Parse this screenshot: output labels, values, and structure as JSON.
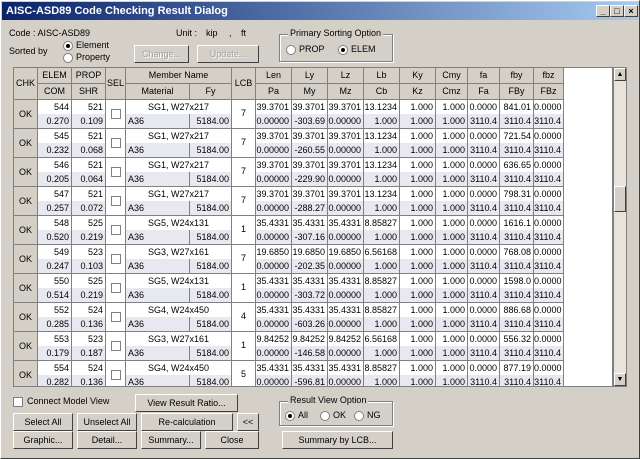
{
  "window": {
    "title": "AISC-ASD89 Code Checking Result Dialog",
    "controls": [
      "_",
      "□",
      "×"
    ]
  },
  "code": {
    "label": "Code : AISC-ASD89"
  },
  "unit": {
    "label": "Unit :",
    "force": "kip",
    "comma": ",",
    "length": "ft"
  },
  "sorted_by": {
    "label": "Sorted by",
    "options": [
      "Element",
      "Property"
    ],
    "selected": 0
  },
  "top_buttons": {
    "change": "Change...",
    "update": "Update..."
  },
  "primary_sort": {
    "title": "Primary Sorting Option",
    "options": [
      "PROP",
      "ELEM"
    ],
    "selected": 1
  },
  "headers": {
    "chk": "CHK",
    "elem": "ELEM",
    "com": "COM",
    "prop": "PROP",
    "shr": "SHR",
    "sel": "SEL",
    "member_name": "Member Name",
    "material": "Material",
    "fy": "Fy",
    "lcb": "LCB",
    "top": [
      "Len",
      "Ly",
      "Lz",
      "Lb",
      "Ky",
      "Cmy",
      "fa",
      "fby",
      "fbz"
    ],
    "bot": [
      "Pa",
      "My",
      "Mz",
      "Cb",
      "Kz",
      "Cmz",
      "Fa",
      "FBy",
      "FBz"
    ]
  },
  "rows": [
    {
      "chk": "OK",
      "elem": "544",
      "com": "0.270",
      "prop": "521",
      "shr": "0.109",
      "name": "SG1, W27x217",
      "mat": "A36",
      "fy": "5184.00",
      "lcb": "7",
      "top": [
        "39.3701",
        "39.3701",
        "39.3701",
        "13.1234",
        "1.000",
        "1.000",
        "0.0000",
        "841.01",
        "0.0000"
      ],
      "bot": [
        "0.00000",
        "-303.69",
        "0.00000",
        "1.000",
        "1.000",
        "1.000",
        "3110.4",
        "3110.4",
        "3110.4"
      ]
    },
    {
      "chk": "OK",
      "elem": "545",
      "com": "0.232",
      "prop": "521",
      "shr": "0.068",
      "name": "SG1, W27x217",
      "mat": "A36",
      "fy": "5184.00",
      "lcb": "7",
      "top": [
        "39.3701",
        "39.3701",
        "39.3701",
        "13.1234",
        "1.000",
        "1.000",
        "0.0000",
        "721.54",
        "0.0000"
      ],
      "bot": [
        "0.00000",
        "-260.55",
        "0.00000",
        "1.000",
        "1.000",
        "1.000",
        "3110.4",
        "3110.4",
        "3110.4"
      ]
    },
    {
      "chk": "OK",
      "elem": "546",
      "com": "0.205",
      "prop": "521",
      "shr": "0.064",
      "name": "SG1, W27x217",
      "mat": "A36",
      "fy": "5184.00",
      "lcb": "7",
      "top": [
        "39.3701",
        "39.3701",
        "39.3701",
        "13.1234",
        "1.000",
        "1.000",
        "0.0000",
        "636.65",
        "0.0000"
      ],
      "bot": [
        "0.00000",
        "-229.90",
        "0.00000",
        "1.000",
        "1.000",
        "1.000",
        "3110.4",
        "3110.4",
        "3110.4"
      ]
    },
    {
      "chk": "OK",
      "elem": "547",
      "com": "0.257",
      "prop": "521",
      "shr": "0.072",
      "name": "SG1, W27x217",
      "mat": "A36",
      "fy": "5184.00",
      "lcb": "7",
      "top": [
        "39.3701",
        "39.3701",
        "39.3701",
        "13.1234",
        "1.000",
        "1.000",
        "0.0000",
        "798.31",
        "0.0000"
      ],
      "bot": [
        "0.00000",
        "-288.27",
        "0.00000",
        "1.000",
        "1.000",
        "1.000",
        "3110.4",
        "3110.4",
        "3110.4"
      ]
    },
    {
      "chk": "OK",
      "elem": "548",
      "com": "0.520",
      "prop": "525",
      "shr": "0.219",
      "name": "SG5, W24x131",
      "mat": "A36",
      "fy": "5184.00",
      "lcb": "1",
      "top": [
        "35.4331",
        "35.4331",
        "35.4331",
        "8.85827",
        "1.000",
        "1.000",
        "0.0000",
        "1616.1",
        "0.0000"
      ],
      "bot": [
        "0.00000",
        "-307.16",
        "0.00000",
        "1.000",
        "1.000",
        "1.000",
        "3110.4",
        "3110.4",
        "3110.4"
      ]
    },
    {
      "chk": "OK",
      "elem": "549",
      "com": "0.247",
      "prop": "523",
      "shr": "0.103",
      "name": "SG3, W27x161",
      "mat": "A36",
      "fy": "5184.00",
      "lcb": "7",
      "top": [
        "19.6850",
        "19.6850",
        "19.6850",
        "6.56168",
        "1.000",
        "1.000",
        "0.0000",
        "768.08",
        "0.0000"
      ],
      "bot": [
        "0.00000",
        "-202.35",
        "0.00000",
        "1.000",
        "1.000",
        "1.000",
        "3110.4",
        "3110.4",
        "3110.4"
      ]
    },
    {
      "chk": "OK",
      "elem": "550",
      "com": "0.514",
      "prop": "525",
      "shr": "0.219",
      "name": "SG5, W24x131",
      "mat": "A36",
      "fy": "5184.00",
      "lcb": "1",
      "top": [
        "35.4331",
        "35.4331",
        "35.4331",
        "8.85827",
        "1.000",
        "1.000",
        "0.0000",
        "1598.0",
        "0.0000"
      ],
      "bot": [
        "0.00000",
        "-303.72",
        "0.00000",
        "1.000",
        "1.000",
        "1.000",
        "3110.4",
        "3110.4",
        "3110.4"
      ]
    },
    {
      "chk": "OK",
      "elem": "552",
      "com": "0.285",
      "prop": "524",
      "shr": "0.136",
      "name": "SG4, W24x450",
      "mat": "A36",
      "fy": "5184.00",
      "lcb": "4",
      "top": [
        "35.4331",
        "35.4331",
        "35.4331",
        "8.85827",
        "1.000",
        "1.000",
        "0.0000",
        "886.68",
        "0.0000"
      ],
      "bot": [
        "0.00000",
        "-603.26",
        "0.00000",
        "1.000",
        "1.000",
        "1.000",
        "3110.4",
        "3110.4",
        "3110.4"
      ]
    },
    {
      "chk": "OK",
      "elem": "553",
      "com": "0.179",
      "prop": "523",
      "shr": "0.187",
      "name": "SG3, W27x161",
      "mat": "A36",
      "fy": "5184.00",
      "lcb": "1",
      "top": [
        "9.84252",
        "9.84252",
        "9.84252",
        "6.56168",
        "1.000",
        "1.000",
        "0.0000",
        "556.32",
        "0.0000"
      ],
      "bot": [
        "0.00000",
        "-146.58",
        "0.00000",
        "1.000",
        "1.000",
        "1.000",
        "3110.4",
        "3110.4",
        "3110.4"
      ]
    },
    {
      "chk": "OK",
      "elem": "554",
      "com": "0.282",
      "prop": "524",
      "shr": "0.136",
      "name": "SG4, W24x450",
      "mat": "A36",
      "fy": "5184.00",
      "lcb": "5",
      "top": [
        "35.4331",
        "35.4331",
        "35.4331",
        "8.85827",
        "1.000",
        "1.000",
        "0.0000",
        "877.19",
        "0.0000"
      ],
      "bot": [
        "0.00000",
        "-596.81",
        "0.00000",
        "1.000",
        "1.000",
        "1.000",
        "3110.4",
        "3110.4",
        "3110.4"
      ]
    }
  ],
  "bottom": {
    "connect": "Connect Model View",
    "view_ratio": "View Result Ratio...",
    "select_all": "Select All",
    "unselect_all": "Unselect All",
    "recalc": "Re-calculation",
    "collapse": "<<",
    "graphic": "Graphic...",
    "detail": "Detail...",
    "summary": "Summary...",
    "close": "Close",
    "result_view": {
      "title": "Result View Option",
      "options": [
        "All",
        "OK",
        "NG"
      ],
      "selected": 0
    },
    "summary_lcb": "Summary by LCB..."
  }
}
